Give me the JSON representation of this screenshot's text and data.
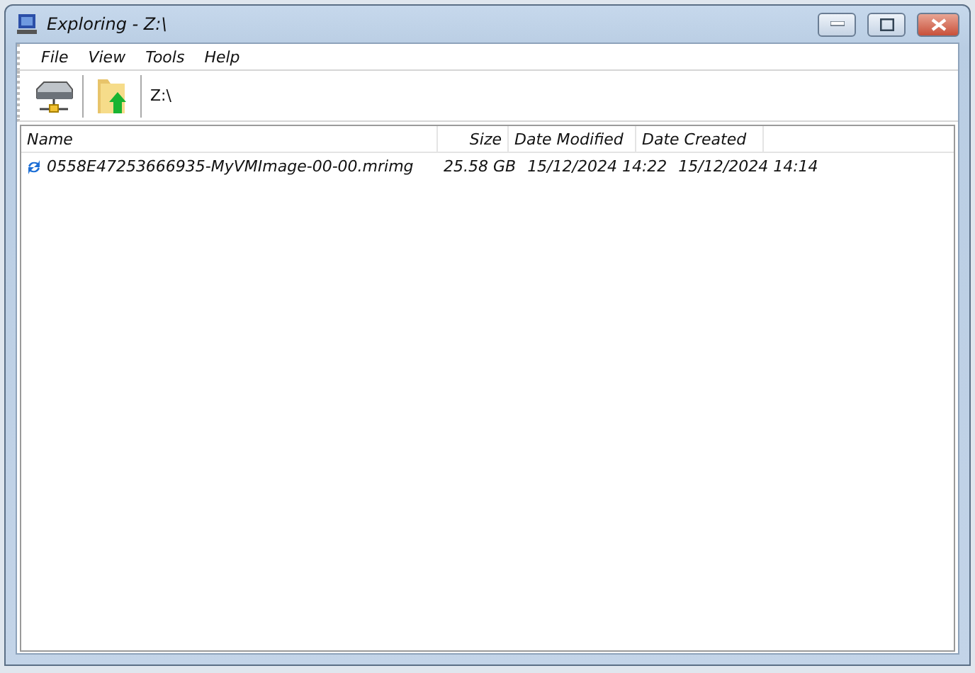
{
  "window": {
    "title": "Exploring - Z:\\"
  },
  "menu": [
    "File",
    "View",
    "Tools",
    "Help"
  ],
  "toolbar": {
    "path": "Z:\\"
  },
  "table": {
    "columns": [
      "Name",
      "Size",
      "Date Modified",
      "Date Created"
    ],
    "rows": [
      {
        "selected": false,
        "cells": [
          "0558E47253666935-MyVMImage-00-00.mrimg",
          "25.58 GB",
          "15/12/2024 14:22",
          "15/12/2024 14:14"
        ]
      }
    ]
  }
}
